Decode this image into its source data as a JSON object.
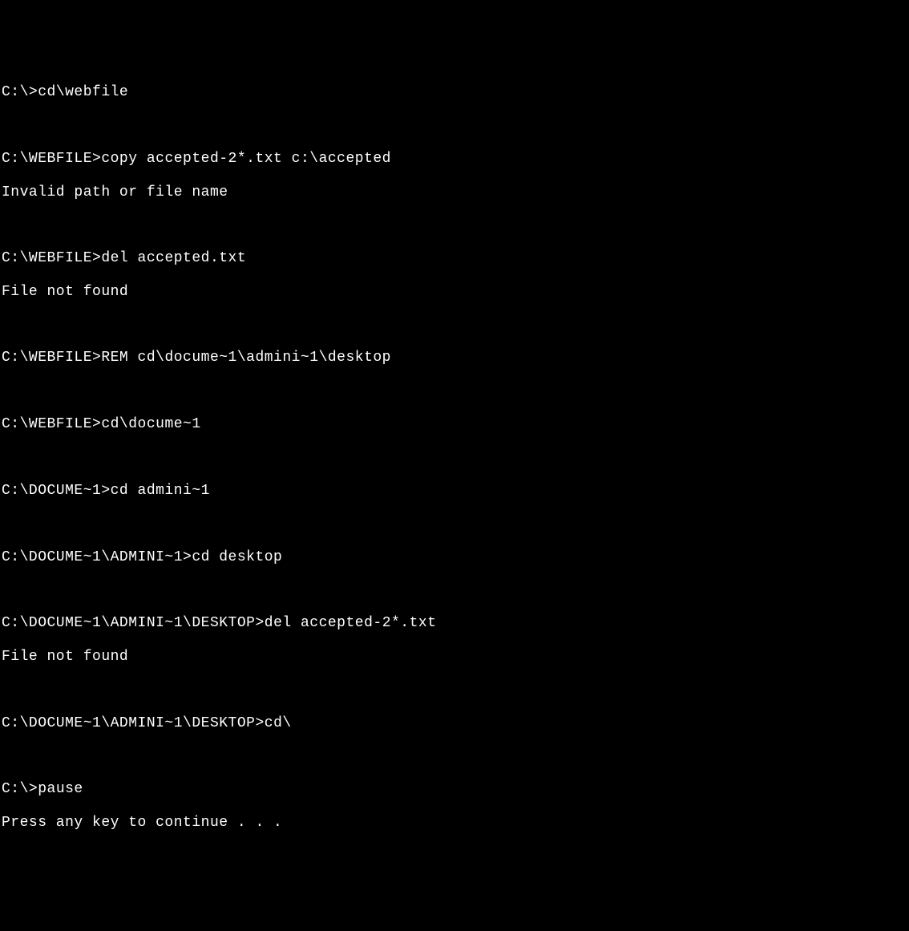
{
  "lines": [
    {
      "prompt": "C:\\>",
      "command": "cd\\webfile",
      "output": ""
    },
    {
      "prompt": "",
      "command": "",
      "output": ""
    },
    {
      "prompt": "C:\\WEBFILE>",
      "command": "copy accepted-2*.txt c:\\accepted",
      "output": ""
    },
    {
      "prompt": "",
      "command": "",
      "output": "Invalid path or file name"
    },
    {
      "prompt": "",
      "command": "",
      "output": ""
    },
    {
      "prompt": "C:\\WEBFILE>",
      "command": "del accepted.txt",
      "output": ""
    },
    {
      "prompt": "",
      "command": "",
      "output": "File not found"
    },
    {
      "prompt": "",
      "command": "",
      "output": ""
    },
    {
      "prompt": "C:\\WEBFILE>",
      "command": "REM cd\\docume~1\\admini~1\\desktop",
      "output": ""
    },
    {
      "prompt": "",
      "command": "",
      "output": ""
    },
    {
      "prompt": "C:\\WEBFILE>",
      "command": "cd\\docume~1",
      "output": ""
    },
    {
      "prompt": "",
      "command": "",
      "output": ""
    },
    {
      "prompt": "C:\\DOCUME~1>",
      "command": "cd admini~1",
      "output": ""
    },
    {
      "prompt": "",
      "command": "",
      "output": ""
    },
    {
      "prompt": "C:\\DOCUME~1\\ADMINI~1>",
      "command": "cd desktop",
      "output": ""
    },
    {
      "prompt": "",
      "command": "",
      "output": ""
    },
    {
      "prompt": "C:\\DOCUME~1\\ADMINI~1\\DESKTOP>",
      "command": "del accepted-2*.txt",
      "output": ""
    },
    {
      "prompt": "",
      "command": "",
      "output": "File not found"
    },
    {
      "prompt": "",
      "command": "",
      "output": ""
    },
    {
      "prompt": "C:\\DOCUME~1\\ADMINI~1\\DESKTOP>",
      "command": "cd\\",
      "output": ""
    },
    {
      "prompt": "",
      "command": "",
      "output": ""
    },
    {
      "prompt": "C:\\>",
      "command": "pause",
      "output": ""
    },
    {
      "prompt": "",
      "command": "",
      "output": "Press any key to continue . . ."
    }
  ]
}
